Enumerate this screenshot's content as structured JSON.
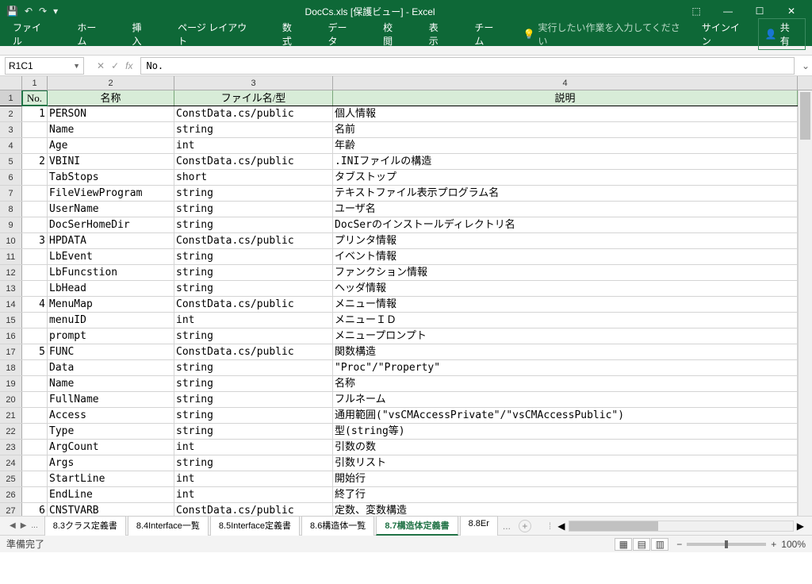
{
  "title": "DocCs.xls  [保護ビュー] - Excel",
  "qat": {
    "save": "💾",
    "undo": "↶",
    "redo": "↷",
    "custom": "▾"
  },
  "wincontrols": {
    "ribbonopt": "⬚",
    "min": "—",
    "max": "☐",
    "close": "✕"
  },
  "ribbon": {
    "tabs": [
      "ファイル",
      "ホーム",
      "挿入",
      "ページ レイアウト",
      "数式",
      "データ",
      "校閲",
      "表示",
      "チーム"
    ],
    "tellme_icon": "💡",
    "tellme": "実行したい作業を入力してください",
    "signin": "サインイン",
    "share_icon": "👤",
    "share": "共有"
  },
  "namebox": "R1C1",
  "fx_cancel": "✕",
  "fx_enter": "✓",
  "fx_label": "fx",
  "fx_value": "No.",
  "columns": [
    "1",
    "2",
    "3",
    "4"
  ],
  "headers": {
    "c1": "No.",
    "c2": "名称",
    "c3": "ファイル名/型",
    "c4": "説明"
  },
  "rows": [
    {
      "n": "2",
      "c1": "1",
      "c2": "PERSON",
      "c3": "ConstData.cs/public",
      "c4": "個人情報"
    },
    {
      "n": "3",
      "c1": "",
      "c2": "Name",
      "c3": "string",
      "c4": "名前"
    },
    {
      "n": "4",
      "c1": "",
      "c2": "Age",
      "c3": "int",
      "c4": "年齢"
    },
    {
      "n": "5",
      "c1": "2",
      "c2": "VBINI",
      "c3": "ConstData.cs/public",
      "c4": ".INIファイルの構造"
    },
    {
      "n": "6",
      "c1": "",
      "c2": "TabStops",
      "c3": "short",
      "c4": "タブストップ"
    },
    {
      "n": "7",
      "c1": "",
      "c2": "FileViewProgram",
      "c3": "string",
      "c4": "テキストファイル表示プログラム名"
    },
    {
      "n": "8",
      "c1": "",
      "c2": "UserName",
      "c3": "string",
      "c4": "ユーザ名"
    },
    {
      "n": "9",
      "c1": "",
      "c2": "DocSerHomeDir",
      "c3": "string",
      "c4": "DocSerのインストールディレクトリ名"
    },
    {
      "n": "10",
      "c1": "3",
      "c2": "HPDATA",
      "c3": "ConstData.cs/public",
      "c4": "プリンタ情報"
    },
    {
      "n": "11",
      "c1": "",
      "c2": "LbEvent",
      "c3": "string",
      "c4": "イベント情報"
    },
    {
      "n": "12",
      "c1": "",
      "c2": "LbFuncstion",
      "c3": "string",
      "c4": "ファンクション情報"
    },
    {
      "n": "13",
      "c1": "",
      "c2": "LbHead",
      "c3": "string",
      "c4": "ヘッダ情報"
    },
    {
      "n": "14",
      "c1": "4",
      "c2": "MenuMap",
      "c3": "ConstData.cs/public",
      "c4": "メニュー情報"
    },
    {
      "n": "15",
      "c1": "",
      "c2": "menuID",
      "c3": "int",
      "c4": "メニューＩＤ"
    },
    {
      "n": "16",
      "c1": "",
      "c2": "prompt",
      "c3": "string",
      "c4": "メニュープロンプト"
    },
    {
      "n": "17",
      "c1": "5",
      "c2": "FUNC",
      "c3": "ConstData.cs/public",
      "c4": "関数構造"
    },
    {
      "n": "18",
      "c1": "",
      "c2": "Data",
      "c3": "string",
      "c4": "\"Proc\"/\"Property\""
    },
    {
      "n": "19",
      "c1": "",
      "c2": "Name",
      "c3": "string",
      "c4": "名称"
    },
    {
      "n": "20",
      "c1": "",
      "c2": "FullName",
      "c3": "string",
      "c4": "フルネーム"
    },
    {
      "n": "21",
      "c1": "",
      "c2": "Access",
      "c3": "string",
      "c4": "通用範囲(\"vsCMAccessPrivate\"/\"vsCMAccessPublic\")"
    },
    {
      "n": "22",
      "c1": "",
      "c2": "Type",
      "c3": "string",
      "c4": "型(string等)"
    },
    {
      "n": "23",
      "c1": "",
      "c2": "ArgCount",
      "c3": "int",
      "c4": "引数の数"
    },
    {
      "n": "24",
      "c1": "",
      "c2": "Args",
      "c3": "string",
      "c4": "引数リスト"
    },
    {
      "n": "25",
      "c1": "",
      "c2": "StartLine",
      "c3": "int",
      "c4": "開始行"
    },
    {
      "n": "26",
      "c1": "",
      "c2": "EndLine",
      "c3": "int",
      "c4": "終了行"
    },
    {
      "n": "27",
      "c1": "6",
      "c2": "CNSTVARB",
      "c3": "ConstData.cs/public",
      "c4": "定数、変数構造"
    }
  ],
  "sheets": {
    "more": "...",
    "tabs": [
      "8.3クラス定義書",
      "8.4Interface一覧",
      "8.5Interface定義書",
      "8.6構造体一覧",
      "8.7構造体定義書",
      "8.8Er"
    ],
    "active": 4,
    "overflow": "..."
  },
  "status": {
    "ready": "準備完了",
    "zoom": "100%",
    "minus": "−",
    "plus": "+"
  }
}
